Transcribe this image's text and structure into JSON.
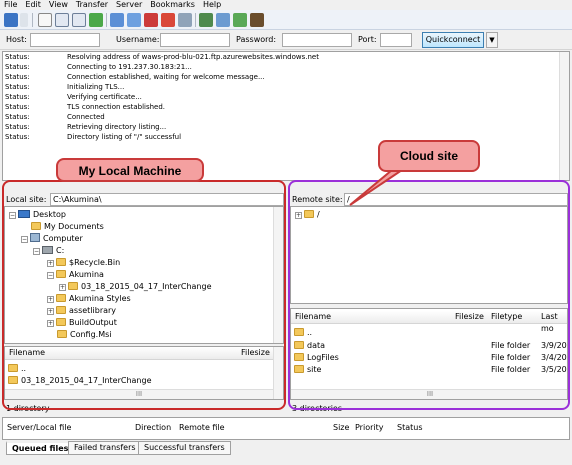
{
  "menu": [
    "File",
    "Edit",
    "View",
    "Transfer",
    "Server",
    "Bookmarks",
    "Help"
  ],
  "quickconnect": {
    "host_label": "Host:",
    "username_label": "Username:",
    "password_label": "Password:",
    "port_label": "Port:",
    "button_label": "Quickconnect",
    "host_value": "",
    "username_value": "",
    "password_value": "",
    "port_value": ""
  },
  "log": [
    {
      "label": "Status:",
      "text": "Resolving address of waws-prod-blu-021.ftp.azurewebsites.windows.net"
    },
    {
      "label": "Status:",
      "text": "Connecting to 191.237.30.183:21..."
    },
    {
      "label": "Status:",
      "text": "Connection established, waiting for welcome message..."
    },
    {
      "label": "Status:",
      "text": "Initializing TLS..."
    },
    {
      "label": "Status:",
      "text": "Verifying certificate..."
    },
    {
      "label": "Status:",
      "text": "TLS connection established."
    },
    {
      "label": "Status:",
      "text": "Connected"
    },
    {
      "label": "Status:",
      "text": "Retrieving directory listing..."
    },
    {
      "label": "Status:",
      "text": "Directory listing of \"/\" successful"
    }
  ],
  "callouts": {
    "local": "My Local Machine",
    "cloud": "Cloud site"
  },
  "local": {
    "site_label": "Local site:",
    "site_value": "C:\\Akumina\\",
    "tree": [
      "Desktop",
      "My Documents",
      "Computer",
      "C:",
      "$Recycle.Bin",
      "Akumina",
      "03_18_2015_04_17_InterChange",
      "Akumina Styles",
      "assetlibrary",
      "BuildOutput",
      "Config.Msi"
    ],
    "columns": {
      "filename": "Filename",
      "filesize": "Filesize"
    },
    "files": [
      "..",
      "03_18_2015_04_17_InterChange"
    ],
    "status": "1 directory",
    "scroll_glyph": "III"
  },
  "remote": {
    "site_label": "Remote site:",
    "site_value": "/",
    "tree": [
      "/"
    ],
    "columns": {
      "filename": "Filename",
      "filesize": "Filesize",
      "filetype": "Filetype",
      "lastmod": "Last mo"
    },
    "files": [
      {
        "name": "..",
        "type": "",
        "date": ""
      },
      {
        "name": "data",
        "type": "File folder",
        "date": "3/9/201"
      },
      {
        "name": "LogFiles",
        "type": "File folder",
        "date": "3/4/201"
      },
      {
        "name": "site",
        "type": "File folder",
        "date": "3/5/201"
      }
    ],
    "status": "3 directories",
    "scroll_glyph": "III"
  },
  "queue": {
    "server_local": "Server/Local file",
    "direction": "Direction",
    "remote_file": "Remote file",
    "size": "Size",
    "priority": "Priority",
    "status": "Status"
  },
  "tabs": [
    "Queued files",
    "Failed transfers",
    "Successful transfers"
  ],
  "colors": {
    "local_outline": "#c92a2a",
    "remote_outline": "#9b30d9",
    "callout_fill": "#f4a0a0"
  }
}
